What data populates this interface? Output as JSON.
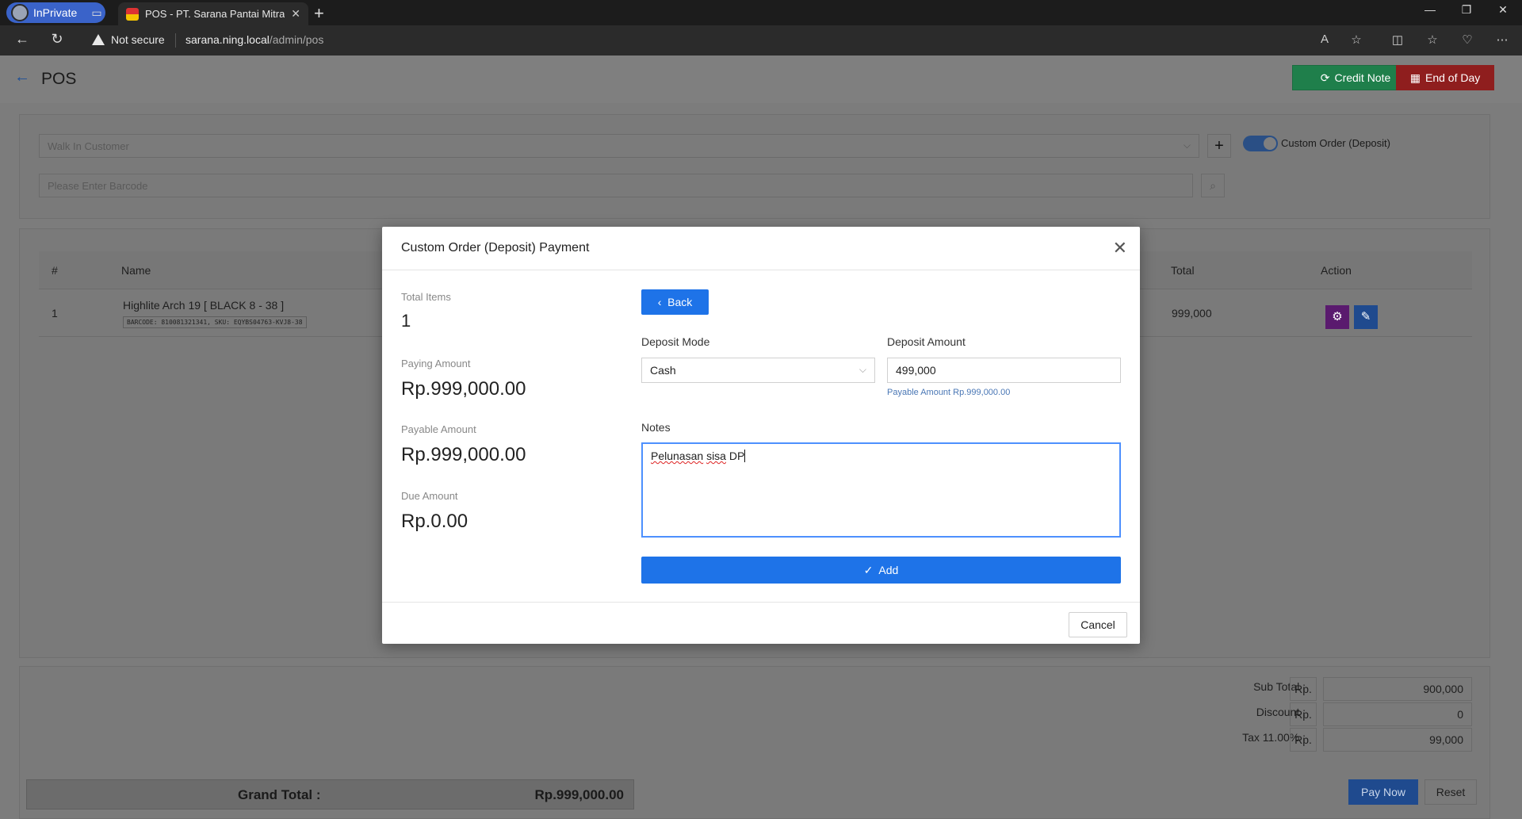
{
  "browser": {
    "inprivate_label": "InPrivate",
    "tab_title": "POS - PT. Sarana Pantai Mitra Se",
    "security_label": "Not secure",
    "url_host": "sarana.ning.local",
    "url_path": "/admin/pos"
  },
  "header": {
    "title": "POS",
    "credit_note_label": "Credit Note",
    "end_of_day_label": "End of Day"
  },
  "filters": {
    "customer_value": "Walk In Customer",
    "custom_order_label": "Custom Order (Deposit)",
    "barcode_placeholder": "Please Enter Barcode"
  },
  "table": {
    "columns": [
      "#",
      "Name",
      "Total",
      "Action"
    ],
    "rows": [
      {
        "index": "1",
        "name": "Highlite Arch 19 [ BLACK 8 - 38 ]",
        "codes": "BARCODE: 810081321341, SKU: EQYBS04763-KVJ8-38",
        "total": "999,000"
      }
    ]
  },
  "summary": {
    "subtotal_label": "Sub Total :",
    "subtotal_prefix": "Rp.",
    "subtotal_value": "900,000",
    "discount_label": "Discount :",
    "discount_prefix": "Rp.",
    "discount_value": "0",
    "tax_label": "Tax 11.00% :",
    "tax_prefix": "Rp.",
    "tax_value": "99,000",
    "grand_total_label": "Grand Total :",
    "grand_total_value": "Rp.999,000.00",
    "pay_now_label": "Pay Now",
    "reset_label": "Reset"
  },
  "modal": {
    "title": "Custom Order (Deposit) Payment",
    "total_items_label": "Total Items",
    "total_items_value": "1",
    "paying_amount_label": "Paying Amount",
    "paying_amount_value": "Rp.999,000.00",
    "payable_amount_label": "Payable Amount",
    "payable_amount_value": "Rp.999,000.00",
    "due_amount_label": "Due Amount",
    "due_amount_value": "Rp.0.00",
    "back_label": "Back",
    "deposit_mode_label": "Deposit Mode",
    "deposit_mode_value": "Cash",
    "deposit_amount_label": "Deposit Amount",
    "deposit_amount_value": "499,000",
    "payable_hint": "Payable Amount Rp.999,000.00",
    "notes_label": "Notes",
    "notes_word1": "Pelunasan",
    "notes_word2": "sisa",
    "notes_word3": "DP",
    "add_label": "Add",
    "cancel_label": "Cancel"
  },
  "colors": {
    "primary": "#1e73e8",
    "credit_note": "#1f7f4b",
    "end_of_day": "#8f1e1e",
    "settings_button": "#5a1a6e",
    "edit_button": "#1f4a8e"
  },
  "icons": [
    "back-arrow-icon",
    "refresh-icon",
    "calculator-icon",
    "chevron-down-icon",
    "plus-icon",
    "search-icon",
    "settings-icon",
    "edit-icon",
    "close-icon",
    "chevron-left-icon",
    "check-icon"
  ]
}
